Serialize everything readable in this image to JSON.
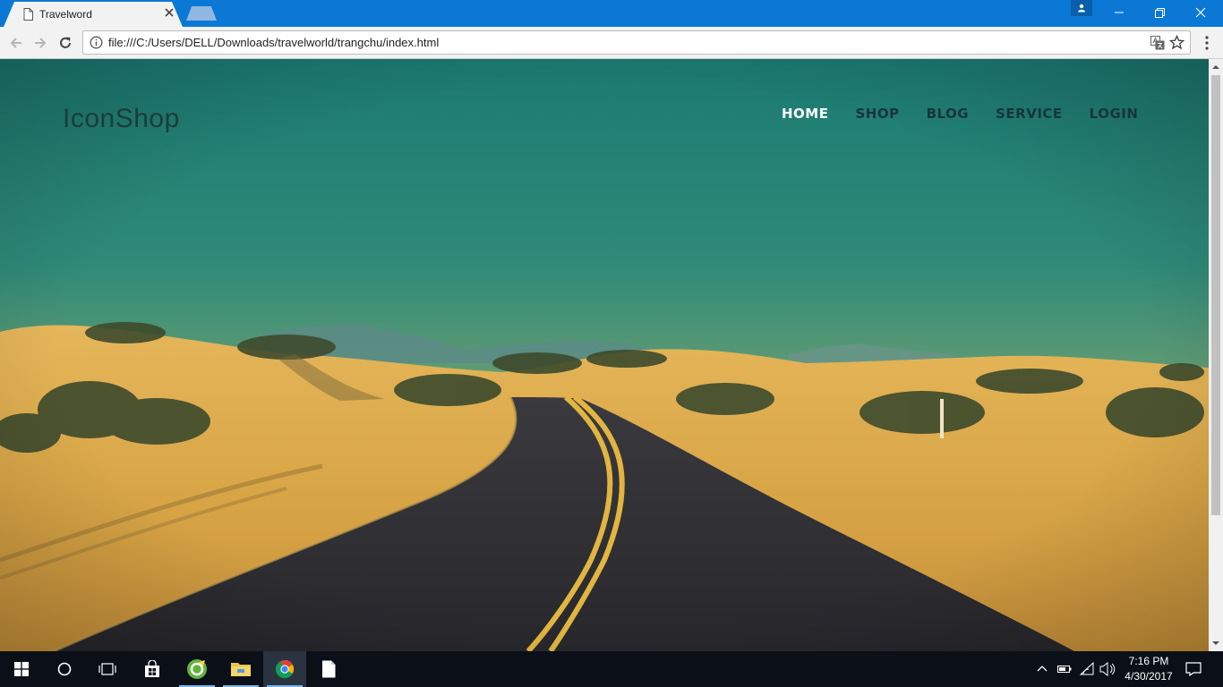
{
  "browser": {
    "tab_title": "Travelword",
    "url": "file:///C:/Users/DELL/Downloads/travelworld/trangchu/index.html"
  },
  "site": {
    "brand": "IconShop",
    "nav": [
      "HOME",
      "SHOP",
      "BLOG",
      "SERVICE",
      "LOGIN"
    ],
    "active_nav": "HOME"
  },
  "taskbar": {
    "time": "7:16 PM",
    "date": "4/30/2017"
  },
  "colors": {
    "titlebar": "#0b78d6",
    "sky_top": "#1e7b72",
    "sand": "#d8a848",
    "road": "#2d2d33",
    "nav_text": "#17353a",
    "nav_active": "#ffffff"
  }
}
